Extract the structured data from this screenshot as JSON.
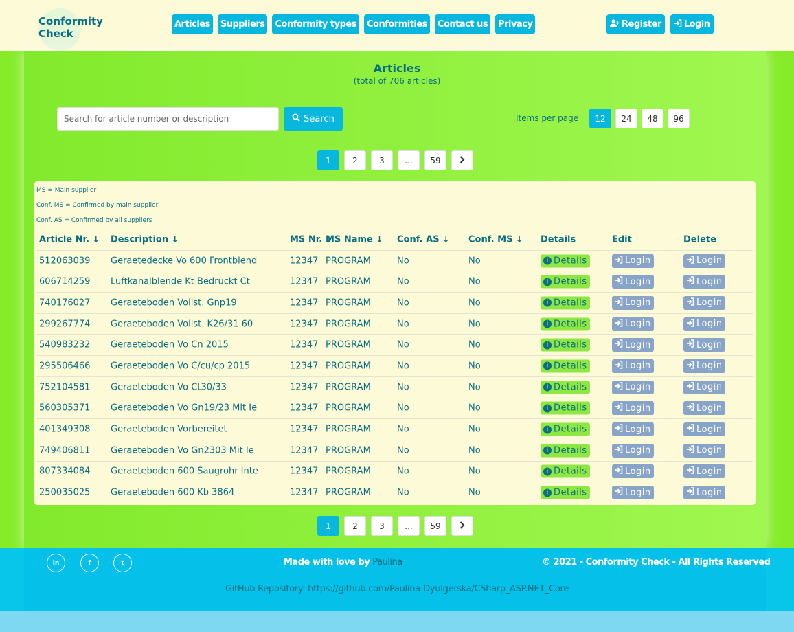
{
  "brand": {
    "name": "Conformity\nCheck"
  },
  "nav": [
    {
      "label": "Articles"
    },
    {
      "label": "Suppliers"
    },
    {
      "label": "Conformity types"
    },
    {
      "label": "Conformities"
    },
    {
      "label": "Contact us"
    },
    {
      "label": "Privacy"
    }
  ],
  "auth": {
    "register_label": "Register",
    "login_label": "Login"
  },
  "page": {
    "title": "Articles",
    "subtitle": "(total of 706 articles)"
  },
  "search": {
    "placeholder": "Search for article number or description",
    "button_label": "Search"
  },
  "items_per_page": {
    "label": "Items per page",
    "options": [
      "12",
      "24",
      "48",
      "96"
    ],
    "selected": "12"
  },
  "pagination": {
    "pages": [
      "1",
      "2",
      "3",
      "...",
      "59"
    ],
    "current": "1"
  },
  "legend": [
    "MS = Main supplier",
    "Conf. MS = Confirmed by main supplier",
    "Conf. AS = Confirmed by all suppliers"
  ],
  "table": {
    "headers": [
      "Article Nr.",
      "Description",
      "MS Nr.",
      "MS Name",
      "Conf. AS",
      "Conf. MS",
      "Details",
      "Edit",
      "Delete"
    ],
    "details_label": "Details",
    "login_label": "Login",
    "rows": [
      {
        "article": "512063039",
        "description": "Geraetedecke Vo 600 Frontblend",
        "ms_nr": "12347",
        "ms_name": "PROGRAM",
        "conf_as": "No",
        "conf_ms": "No"
      },
      {
        "article": "606714259",
        "description": "Luftkanalblende Kt Bedruckt Ct",
        "ms_nr": "12347",
        "ms_name": "PROGRAM",
        "conf_as": "No",
        "conf_ms": "No"
      },
      {
        "article": "740176027",
        "description": "Geraeteboden Vollst. Gnp19",
        "ms_nr": "12347",
        "ms_name": "PROGRAM",
        "conf_as": "No",
        "conf_ms": "No"
      },
      {
        "article": "299267774",
        "description": "Geraeteboden Vollst. K26/31 60",
        "ms_nr": "12347",
        "ms_name": "PROGRAM",
        "conf_as": "No",
        "conf_ms": "No"
      },
      {
        "article": "540983232",
        "description": "Geraeteboden Vo Cn 2015",
        "ms_nr": "12347",
        "ms_name": "PROGRAM",
        "conf_as": "No",
        "conf_ms": "No"
      },
      {
        "article": "295506466",
        "description": "Geraeteboden Vo C/cu/cp 2015",
        "ms_nr": "12347",
        "ms_name": "PROGRAM",
        "conf_as": "No",
        "conf_ms": "No"
      },
      {
        "article": "752104581",
        "description": "Geraeteboden Vo Ct30/33",
        "ms_nr": "12347",
        "ms_name": "PROGRAM",
        "conf_as": "No",
        "conf_ms": "No"
      },
      {
        "article": "560305371",
        "description": "Geraeteboden Vo Gn19/23 Mit Ie",
        "ms_nr": "12347",
        "ms_name": "PROGRAM",
        "conf_as": "No",
        "conf_ms": "No"
      },
      {
        "article": "401349308",
        "description": "Geraeteboden Vorbereitet",
        "ms_nr": "12347",
        "ms_name": "PROGRAM",
        "conf_as": "No",
        "conf_ms": "No"
      },
      {
        "article": "749406811",
        "description": "Geraeteboden Vo Gn2303 Mit Ie",
        "ms_nr": "12347",
        "ms_name": "PROGRAM",
        "conf_as": "No",
        "conf_ms": "No"
      },
      {
        "article": "807334084",
        "description": "Geraeteboden 600 Saugrohr Inte",
        "ms_nr": "12347",
        "ms_name": "PROGRAM",
        "conf_as": "No",
        "conf_ms": "No"
      },
      {
        "article": "250035025",
        "description": "Geraeteboden 600 Kb 3864",
        "ms_nr": "12347",
        "ms_name": "PROGRAM",
        "conf_as": "No",
        "conf_ms": "No"
      }
    ]
  },
  "footer": {
    "made_prefix": "Made with love by ",
    "made_name": "Paulina",
    "copyright": "© 2021 - Conformity Check - All Rights Reserved",
    "repo": "GitHub Repository: https://github.com/Paulina-Dyulgerska/CSharp_ASP.NET_Core",
    "social": [
      "in",
      "f",
      "t"
    ]
  },
  "colors": {
    "accent": "#07b7de",
    "text": "#0a6f82",
    "bg_green": "#86ec2a",
    "panel": "#fdfad8",
    "details_btn": "#8ee742",
    "login_btn": "#89a4c9"
  }
}
